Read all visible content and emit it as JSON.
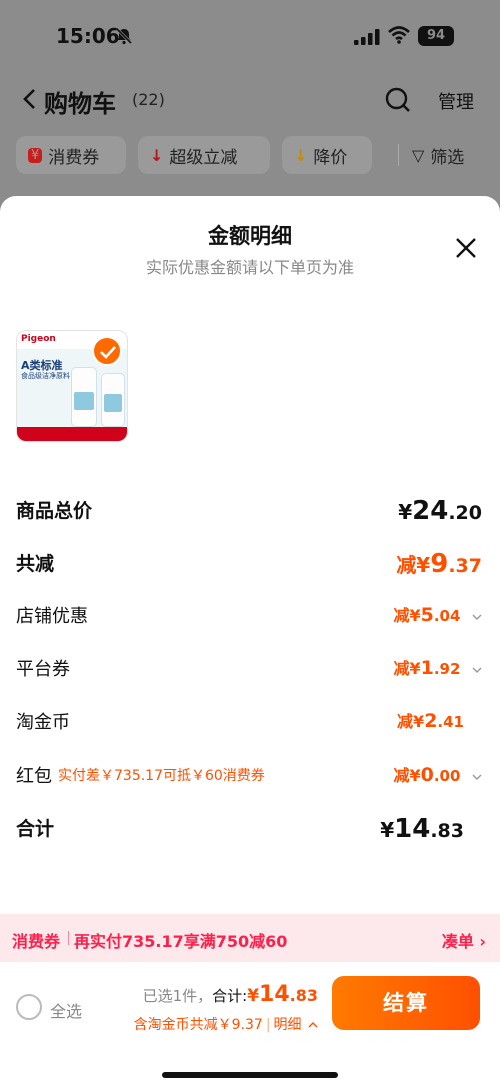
{
  "status_bar": {
    "time": "15:06",
    "battery": "94"
  },
  "nav": {
    "title": "购物车",
    "count": "(22)",
    "manage": "管理"
  },
  "filters": [
    {
      "icon": "¥",
      "label": "消费券"
    },
    {
      "icon": "↓",
      "label": "超级立减"
    },
    {
      "icon": "↓",
      "label": "降价"
    },
    {
      "icon": "▽",
      "label": "筛选"
    }
  ],
  "sheet": {
    "title": "金额明细",
    "subtitle": "实际优惠金额请以下单页为准",
    "product": {
      "brand": "Pigeon",
      "headline": "A类标准",
      "subline": "食品级洁净原料"
    },
    "rows": {
      "goods_total": {
        "label": "商品总价",
        "yen": "¥",
        "int": "24",
        "dec": ".20"
      },
      "total_discount": {
        "label": "共减",
        "prefix": "减¥",
        "int": "9",
        "dec": ".37"
      },
      "shop_discount": {
        "label": "店铺优惠",
        "prefix": "减¥",
        "int": "5",
        "dec": ".04"
      },
      "platform_coupon": {
        "label": "平台券",
        "prefix": "减¥",
        "int": "1",
        "dec": ".92"
      },
      "taojinbi": {
        "label": "淘金币",
        "prefix": "减¥",
        "int": "2",
        "dec": ".41"
      },
      "hongbao": {
        "label": "红包",
        "note": "实付差￥735.17可抵￥60消费券",
        "prefix": "减¥",
        "int": "0",
        "dec": ".00"
      },
      "subtotal": {
        "label": "合计",
        "yen": "¥",
        "int": "14",
        "dec": ".83"
      }
    }
  },
  "voucher_banner": {
    "tag": "消费券",
    "text": "再实付735.17享满750减60",
    "action": "凑单"
  },
  "bottom_bar": {
    "select_all": "全选",
    "selected": "已选1件，",
    "total_label": "合计:",
    "yen": "¥",
    "int": "14",
    "dec": ".83",
    "discount_note": "含淘金币共减￥9.37",
    "detail": "明细",
    "checkout": "结算"
  },
  "colors": {
    "accent": "#ff5000",
    "voucher_red": "#ff1f4b",
    "banner_bg": "#fde9ec"
  }
}
